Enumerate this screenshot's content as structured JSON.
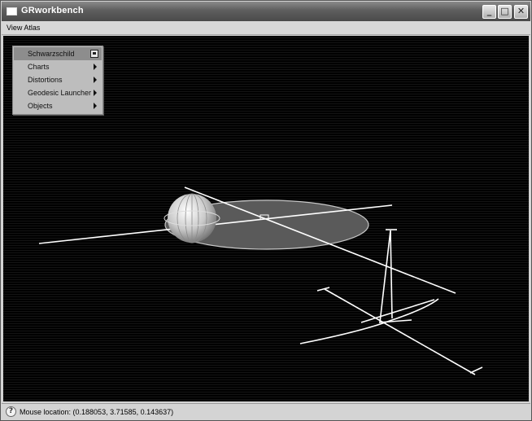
{
  "window": {
    "title": "GRworkbench"
  },
  "titlebar_buttons": {
    "minimize": "_",
    "maximize": "□",
    "close": "✕"
  },
  "menubar": {
    "items": [
      "View Atlas"
    ]
  },
  "popup_menu": {
    "header": "Schwarzschild",
    "items": [
      {
        "label": "Charts"
      },
      {
        "label": "Distortions"
      },
      {
        "label": "Geodesic Launcher"
      },
      {
        "label": "Objects"
      }
    ]
  },
  "statusbar": {
    "help_icon": "?",
    "text": "Mouse location: (0.188053, 3.71585, 0.143637)"
  },
  "colors": {
    "viewport_bg": "#000000",
    "lines": "#ffffff",
    "disk": "#5a5a5a"
  }
}
